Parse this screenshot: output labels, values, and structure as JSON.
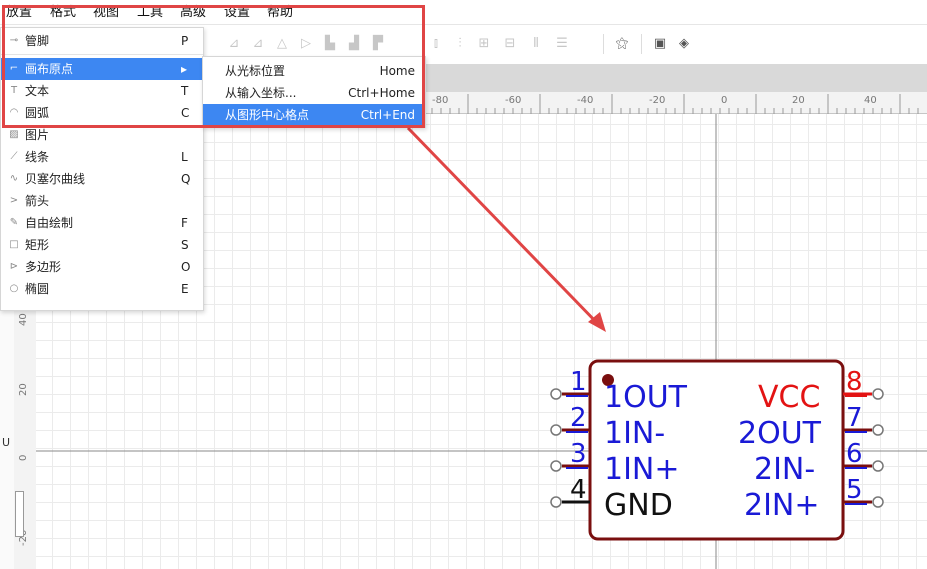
{
  "menubar": {
    "items": [
      "放置",
      "格式",
      "视图",
      "工具",
      "高级",
      "设置",
      "帮助"
    ]
  },
  "dropdown": {
    "items": [
      {
        "label": "管脚",
        "shortcut": "P",
        "icon": "pin-icon"
      },
      {
        "label": "画布原点",
        "shortcut": "▸",
        "icon": "origin-icon",
        "active": true
      },
      {
        "label": "文本",
        "shortcut": "T",
        "icon": "text-icon"
      },
      {
        "label": "圆弧",
        "shortcut": "C",
        "icon": "arc-icon"
      },
      {
        "label": "图片",
        "shortcut": "",
        "icon": "image-icon"
      },
      {
        "label": "线条",
        "shortcut": "L",
        "icon": "line-icon"
      },
      {
        "label": "贝塞尔曲线",
        "shortcut": "Q",
        "icon": "bezier-icon"
      },
      {
        "label": "箭头",
        "shortcut": "",
        "icon": "arrow-icon"
      },
      {
        "label": "自由绘制",
        "shortcut": "F",
        "icon": "pencil-icon"
      },
      {
        "label": "矩形",
        "shortcut": "S",
        "icon": "rectangle-icon"
      },
      {
        "label": "多边形",
        "shortcut": "O",
        "icon": "polygon-icon"
      },
      {
        "label": "椭圆",
        "shortcut": "E",
        "icon": "ellipse-icon"
      }
    ]
  },
  "submenu": {
    "items": [
      {
        "label": "从光标位置",
        "shortcut": "Home"
      },
      {
        "label": "从输入坐标...",
        "shortcut": "Ctrl+Home"
      },
      {
        "label": "从图形中心格点",
        "shortcut": "Ctrl+End",
        "active": true
      }
    ]
  },
  "ruler": {
    "h_labels": [
      "-80",
      "-60",
      "-40",
      "-20",
      "0",
      "20",
      "40"
    ],
    "v_labels": [
      "40",
      "20",
      "0",
      "-20"
    ]
  },
  "left_panel": {
    "text": "U"
  },
  "component": {
    "left_pins": [
      {
        "number": "1",
        "name": "1OUT"
      },
      {
        "number": "2",
        "name": "1IN-"
      },
      {
        "number": "3",
        "name": "1IN+"
      },
      {
        "number": "4",
        "name": "GND"
      }
    ],
    "right_pins": [
      {
        "number": "8",
        "name": "VCC"
      },
      {
        "number": "7",
        "name": "2OUT"
      },
      {
        "number": "6",
        "name": "2IN-"
      },
      {
        "number": "5",
        "name": "2IN+"
      }
    ]
  },
  "colors": {
    "accent": "#3d87f2",
    "highlight": "#e04545",
    "body_outline": "#7a0f0f",
    "pin_text": "#1a1ad6",
    "power_text": "#e31313"
  }
}
